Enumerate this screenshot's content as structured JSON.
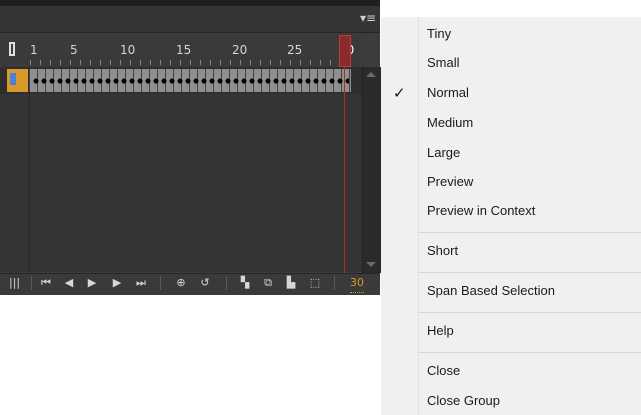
{
  "timeline": {
    "panel_menu_icon": "panel-menu-icon",
    "ruler_labels": [
      "1",
      "5",
      "10",
      "15",
      "20",
      "25",
      "30"
    ],
    "current_frame": "30",
    "colors": {
      "keyframe": "#d89a2a",
      "playhead": "#b02a2a",
      "frame_counter": "#d99a2a"
    }
  },
  "menu": {
    "items": [
      {
        "label": "Tiny"
      },
      {
        "label": "Small"
      },
      {
        "label": "Normal",
        "checked": true
      },
      {
        "label": "Medium"
      },
      {
        "label": "Large"
      },
      {
        "label": "Preview"
      },
      {
        "label": "Preview in Context"
      },
      {
        "label": "Short"
      },
      {
        "label": "Span Based Selection"
      },
      {
        "label": "Help"
      },
      {
        "label": "Close"
      },
      {
        "label": "Close Group"
      }
    ],
    "check_glyph": "✓"
  },
  "controls": {
    "icons": [
      "layers-toggle-icon",
      "first-frame-icon",
      "step-back-icon",
      "play-icon",
      "step-forward-icon",
      "last-frame-icon",
      "center-frame-icon",
      "loop-icon",
      "onion-skin-icon",
      "onion-outline-icon",
      "edit-multiple-icon",
      "modify-markers-icon"
    ]
  }
}
